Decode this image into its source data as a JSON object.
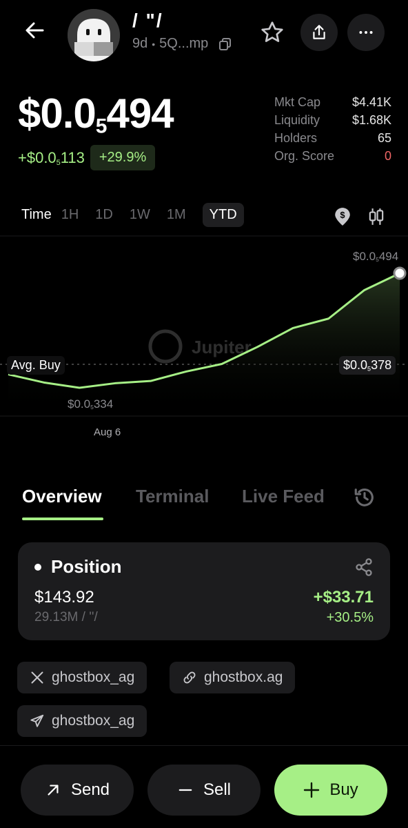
{
  "header": {
    "token_name": "/ \"/",
    "age": "9d",
    "address": "5Q...mp"
  },
  "price": {
    "main": "$0.0",
    "main_sub": "5",
    "main_tail": "494",
    "change_abs_prefix": "+$0.0",
    "change_abs_sub": "5",
    "change_abs_tail": "113",
    "change_pct": "+29.9%"
  },
  "stats": [
    {
      "label": "Mkt Cap",
      "value": "$4.41K"
    },
    {
      "label": "Liquidity",
      "value": "$1.68K"
    },
    {
      "label": "Holders",
      "value": "65"
    },
    {
      "label": "Org. Score",
      "value": "0"
    }
  ],
  "time_tabs": {
    "label": "Time",
    "options": [
      "1H",
      "1D",
      "1W",
      "1M",
      "YTD"
    ],
    "selected": "YTD"
  },
  "chart_data": {
    "type": "area",
    "x_label_shown": "Aug 6",
    "y_values_scaled": [
      4.05,
      3.62,
      3.34,
      3.58,
      3.7,
      4.2,
      4.6,
      5.5,
      6.5,
      7.0,
      8.5,
      9.4
    ],
    "high_label": {
      "prefix": "$0.0",
      "sub": "5",
      "tail": "494"
    },
    "low_label": {
      "prefix": "$0.0",
      "sub": "5",
      "tail": "334"
    },
    "avg_buy_label": "Avg. Buy",
    "avg_buy_value": {
      "prefix": "$0.0",
      "sub": "5",
      "tail": "378"
    },
    "watermark": "Jupiter",
    "colors": {
      "line": "#a6ef86",
      "fill": "#1e2a1a"
    }
  },
  "section_tabs": [
    "Overview",
    "Terminal",
    "Live Feed"
  ],
  "position": {
    "title": "Position",
    "value": "$143.92",
    "amount": "29.13M / ''/",
    "pnl": "+$33.71",
    "pnl_pct": "+30.5%"
  },
  "links": [
    {
      "icon": "x-logo-icon",
      "label": "ghostbox_ag"
    },
    {
      "icon": "link-icon",
      "label": "ghostbox.ag"
    },
    {
      "icon": "telegram-icon",
      "label": "ghostbox_ag"
    }
  ],
  "actions": {
    "send": "Send",
    "sell": "Sell",
    "buy": "Buy"
  },
  "colors": {
    "accent": "#a6ef86",
    "negative": "#f06666",
    "muted": "#8a8a8e",
    "card": "#1c1c1e"
  }
}
